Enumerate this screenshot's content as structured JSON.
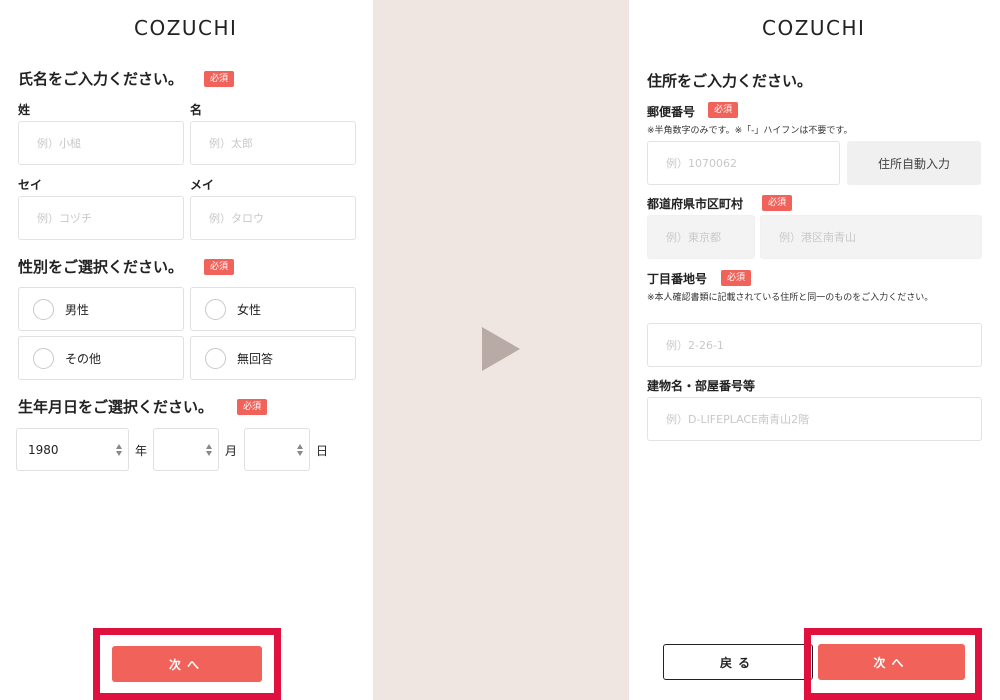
{
  "logo": "COZUCHI",
  "required_badge": "必須",
  "left": {
    "name_heading": "氏名をご入力ください。",
    "last_name_label": "姓",
    "last_name_placeholder": "例）小槌",
    "first_name_label": "名",
    "first_name_placeholder": "例）太郎",
    "last_kana_label": "セイ",
    "last_kana_placeholder": "例）コヅチ",
    "first_kana_label": "メイ",
    "first_kana_placeholder": "例）タロウ",
    "gender_heading": "性別をご選択ください。",
    "gender_options": [
      "男性",
      "女性",
      "その他",
      "無回答"
    ],
    "birthday_heading": "生年月日をご選択ください。",
    "year_value": "1980",
    "year_unit": "年",
    "month_value": "",
    "month_unit": "月",
    "day_value": "",
    "day_unit": "日",
    "next_button": "次へ"
  },
  "right": {
    "address_heading": "住所をご入力ください。",
    "postal_label": "郵便番号",
    "postal_note": "※半角数字のみです。※「-」ハイフンは不要です。",
    "postal_placeholder": "例）1070062",
    "auto_fill_button": "住所自動入力",
    "prefecture_label": "都道府県市区町村",
    "prefecture_placeholder": "例）東京都",
    "city_placeholder": "例）港区南青山",
    "street_label": "丁目番地号",
    "street_note": "※本人確認書類に記載されている住所と同一のものをご入力ください。",
    "street_placeholder": "例）2-26-1",
    "building_label": "建物名・部屋番号等",
    "building_placeholder": "例）D-LIFEPLACE南青山2階",
    "back_button": "戻る",
    "next_button": "次へ"
  },
  "colors": {
    "accent": "#f0625a",
    "highlight": "#e0113e",
    "background": "#efe6e2",
    "arrow": "#b8aaa4"
  }
}
